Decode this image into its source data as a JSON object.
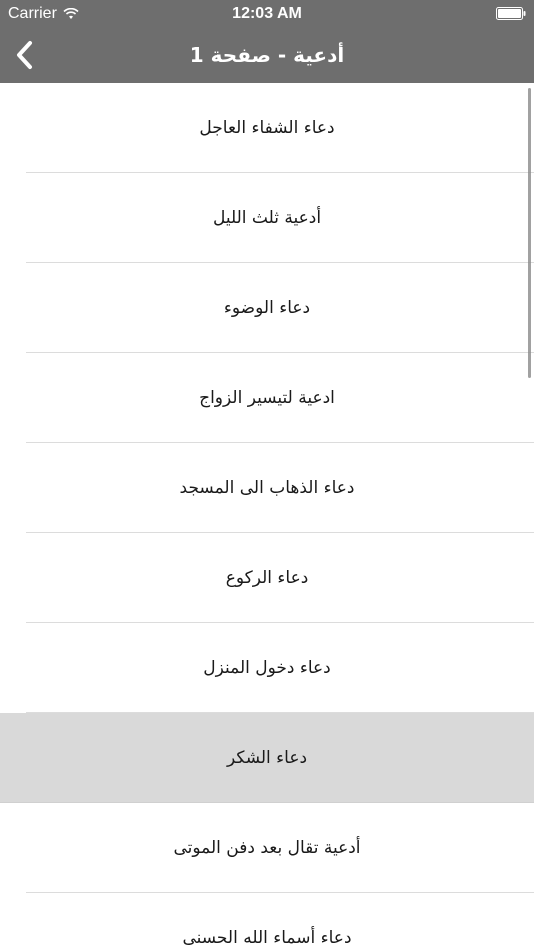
{
  "status_bar": {
    "carrier": "Carrier",
    "time": "12:03 AM"
  },
  "nav": {
    "title": "أدعية - صفحة 1",
    "back_icon": "chevron-left-icon"
  },
  "list": {
    "items": [
      {
        "label": "دعاء الشفاء العاجل"
      },
      {
        "label": "أدعية ثلث الليل"
      },
      {
        "label": "دعاء الوضوء"
      },
      {
        "label": "ادعية لتيسير الزواج"
      },
      {
        "label": "دعاء الذهاب الى المسجد"
      },
      {
        "label": "دعاء الركوع"
      },
      {
        "label": "دعاء دخول المنزل"
      },
      {
        "label": "دعاء الشكر",
        "selected": true
      },
      {
        "label": "أدعية تقال بعد دفن الموتى"
      },
      {
        "label": "دعاء أسماء الله الحسنى"
      }
    ]
  },
  "colors": {
    "bar_background": "#6e6e6e",
    "selected_row": "#d9d9d9",
    "separator": "#dcdcdc"
  }
}
